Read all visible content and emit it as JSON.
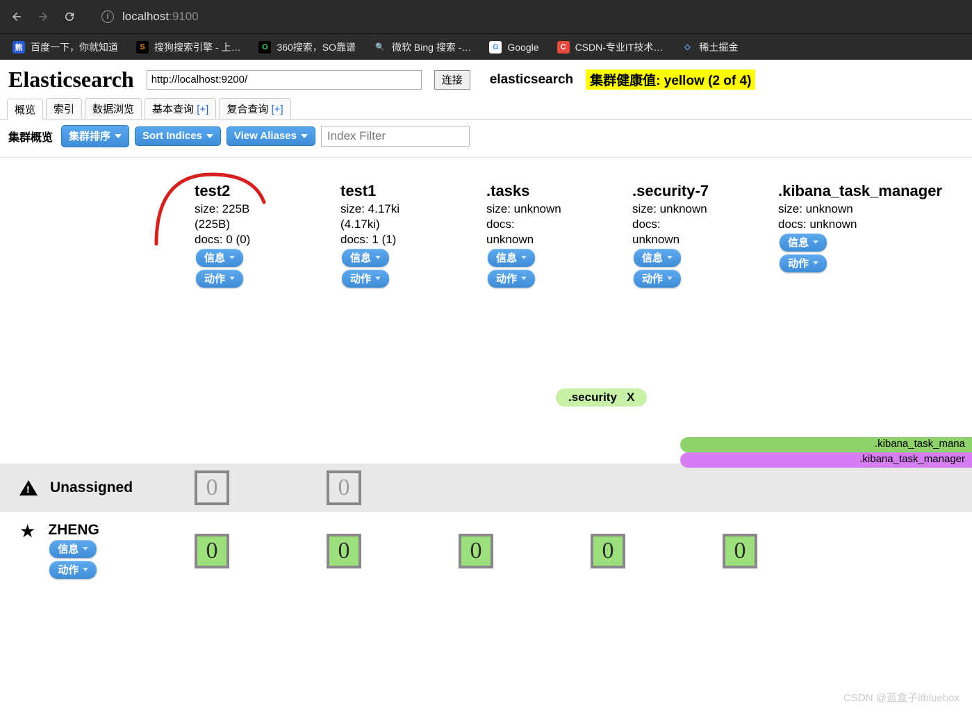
{
  "browser": {
    "url_host": "localhost",
    "url_port": ":9100",
    "bookmarks": [
      {
        "label": "百度一下，你就知道",
        "bg": "#2a59d6",
        "fg": "#fff",
        "glyph": "熊"
      },
      {
        "label": "搜狗搜索引擎 - 上…",
        "bg": "#000",
        "fg": "#f48b1a",
        "glyph": "S"
      },
      {
        "label": "360搜索，SO靠谱",
        "bg": "#000",
        "fg": "#3fd15e",
        "glyph": "O"
      },
      {
        "label": "微软 Bing 搜索 -…",
        "bg": "transparent",
        "fg": "#3da4ff",
        "glyph": "🔍"
      },
      {
        "label": "Google",
        "bg": "#fff",
        "fg": "#4285f4",
        "glyph": "G"
      },
      {
        "label": "CSDN-专业IT技术…",
        "bg": "#e74a3b",
        "fg": "#fff",
        "glyph": "C"
      },
      {
        "label": "稀土掘金",
        "bg": "transparent",
        "fg": "#6ba8ff",
        "glyph": "◇"
      }
    ]
  },
  "head": {
    "title": "Elasticsearch",
    "conn_value": "http://localhost:9200/",
    "conn_btn": "连接",
    "cluster_name": "elasticsearch",
    "health": "集群健康值: yellow (2 of 4)"
  },
  "tabs": [
    {
      "label": "概览",
      "active": true
    },
    {
      "label": "索引"
    },
    {
      "label": "数据浏览"
    },
    {
      "label": "基本查询",
      "plus": "[+]"
    },
    {
      "label": "复合查询",
      "plus": "[+]"
    }
  ],
  "toolbar": {
    "label": "集群概览",
    "btn1": "集群排序",
    "btn2": "Sort Indices",
    "btn3": "View Aliases",
    "filter_placeholder": "Index Filter"
  },
  "index_btn_info": "信息",
  "index_btn_action": "动作",
  "indices": [
    {
      "name": "test2",
      "lines": [
        "size: 225B",
        "(225B)",
        "docs: 0 (0)"
      ]
    },
    {
      "name": "test1",
      "lines": [
        "size: 4.17ki",
        "(4.17ki)",
        "docs: 1 (1)"
      ]
    },
    {
      "name": ".tasks",
      "lines": [
        "size: unknown",
        "docs:",
        "unknown"
      ]
    },
    {
      "name": ".security-7",
      "lines": [
        "size: unknown",
        "docs:",
        "unknown"
      ]
    },
    {
      "name": ".kibana_task_manager",
      "lines": [
        "size: unknown",
        "docs: unknown"
      ]
    }
  ],
  "tags": {
    "security": ".security",
    "security_x": "X",
    "ribbon1": ".kibana_task_mana",
    "ribbon2": ".kibana_task_manager"
  },
  "rows": {
    "unassigned_label": "Unassigned",
    "node_name": "ZHENG",
    "node_btn_info": "信息",
    "node_btn_action": "动作",
    "unassigned_shards": [
      "0",
      "0"
    ],
    "node_shards": [
      "0",
      "0",
      "0",
      "0",
      "0"
    ]
  },
  "watermark": "CSDN @蓝盒子itbluebox"
}
